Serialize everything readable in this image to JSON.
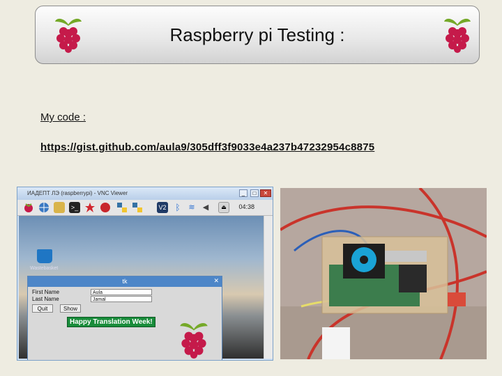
{
  "header": {
    "title": "Raspberry pi Testing :"
  },
  "code": {
    "label": "My code :",
    "link": "https://gist.github.com/aula9/305dff3f9033e4a237b47232954c8875"
  },
  "vnc": {
    "window_title": "ИАДЕПТ ЛЭ (raspberrypi) - VNC Viewer",
    "clock": "04:38",
    "desktop_label": "Wastebasket",
    "tk_window": {
      "title": "tk",
      "close": "✕",
      "first_name_label": "First Name",
      "last_name_label": "Last Name",
      "first_name_value": "Aula",
      "last_name_value": "Jamal",
      "quit_label": "Quit",
      "show_label": "Show",
      "message": "Happy Translation Week!"
    }
  },
  "colors": {
    "background": "#eeece1",
    "raspberry_red": "#c51a4a",
    "leaf_green": "#75a928"
  }
}
